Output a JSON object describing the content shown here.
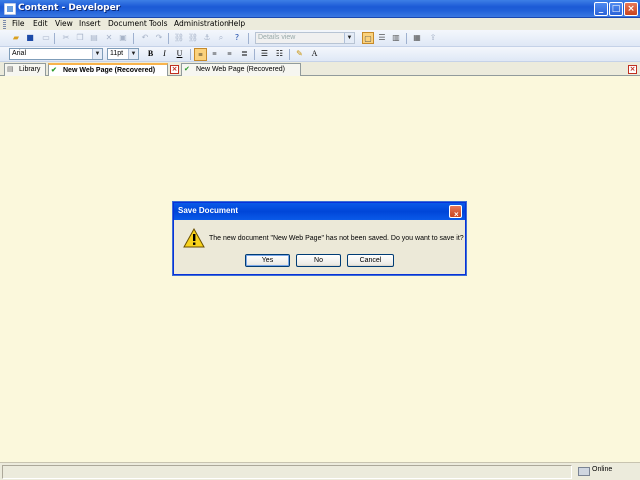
{
  "window": {
    "title": "Content - Developer"
  },
  "menu": [
    "File",
    "Edit",
    "View",
    "Insert",
    "Document",
    "Tools",
    "Administration",
    "Help"
  ],
  "toolbar": {
    "view_combo": "Details view"
  },
  "format_toolbar": {
    "font": "Arial",
    "size": "11pt",
    "bold": "B",
    "italic": "I",
    "underline": "U"
  },
  "tabs": {
    "library": "Library",
    "active_tab": "New Web Page (Recovered)",
    "second_tab": "New Web Page (Recovered)"
  },
  "status": {
    "online": "Online"
  },
  "dialog": {
    "title": "Save Document",
    "message": "The new document \"New Web Page\" has not been saved. Do you want to save it?",
    "yes": "Yes",
    "no": "No",
    "cancel": "Cancel"
  },
  "icons": {
    "warning": "warning-icon",
    "close": "close-icon",
    "minimize": "minimize-icon",
    "maximize": "maximize-icon"
  },
  "colors": {
    "titlebar": "#0a5ae8",
    "editor_background": "#fbf8dc",
    "chrome": "#ecebdc",
    "close_red": "#c8431e"
  }
}
